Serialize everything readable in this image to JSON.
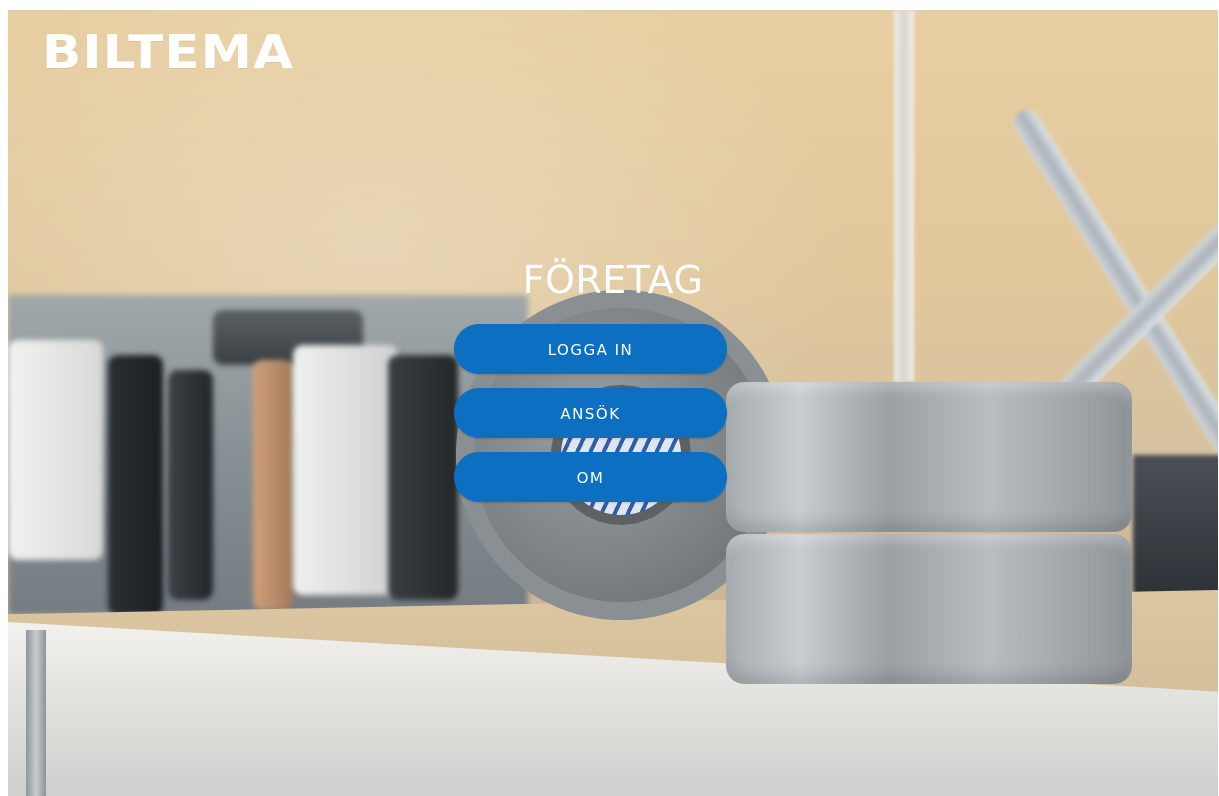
{
  "brand": {
    "logo_text": "BILTEMA"
  },
  "main": {
    "title": "FÖRETAG",
    "buttons": [
      {
        "label": "LOGGA IN"
      },
      {
        "label": "ANSÖK"
      },
      {
        "label": "OM"
      }
    ]
  },
  "colors": {
    "button_background": "#0c6fc2",
    "button_text": "#ffffff",
    "title_text": "#ffffff"
  }
}
